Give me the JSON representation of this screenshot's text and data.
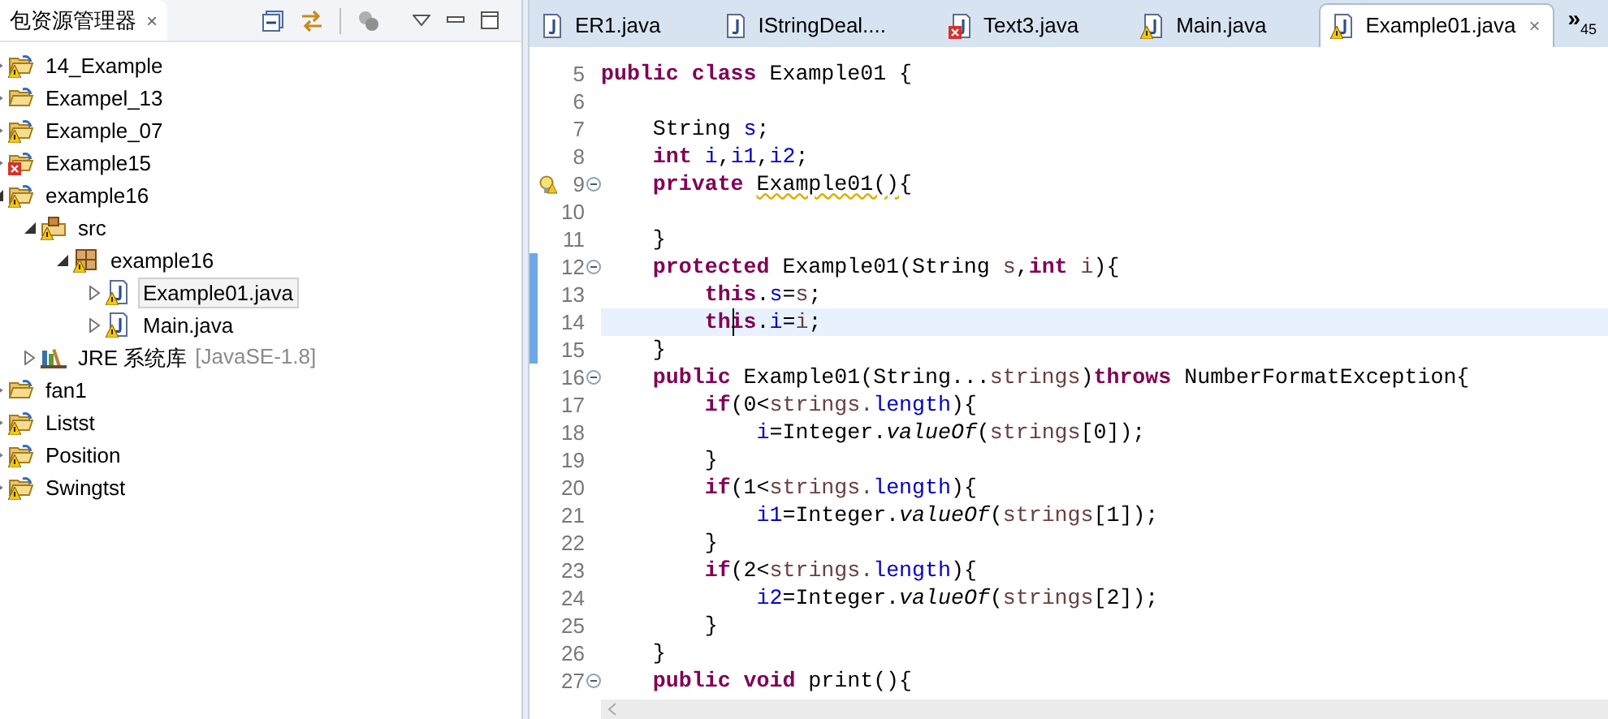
{
  "explorer": {
    "title": "包资源管理器",
    "close": "×",
    "tree": [
      {
        "label": "14_Example",
        "kind": "project",
        "warning": true,
        "error": false,
        "expanded": false,
        "selected": false
      },
      {
        "label": "Exampel_13",
        "kind": "project",
        "warning": false,
        "error": false,
        "expanded": false,
        "selected": false
      },
      {
        "label": "Example_07",
        "kind": "project",
        "warning": true,
        "error": false,
        "expanded": false,
        "selected": false
      },
      {
        "label": "Example15",
        "kind": "project",
        "warning": false,
        "error": true,
        "expanded": false,
        "selected": false
      },
      {
        "label": "example16",
        "kind": "project",
        "warning": true,
        "error": false,
        "expanded": true,
        "selected": false,
        "children": [
          {
            "label": "src",
            "kind": "source-folder",
            "warning": true,
            "error": false,
            "expanded": true,
            "selected": false,
            "children": [
              {
                "label": "example16",
                "kind": "package",
                "warning": true,
                "error": false,
                "expanded": true,
                "selected": false,
                "children": [
                  {
                    "label": "Example01.java",
                    "kind": "java-file",
                    "warning": true,
                    "error": false,
                    "expanded": false,
                    "selected": true
                  },
                  {
                    "label": "Main.java",
                    "kind": "java-file",
                    "warning": true,
                    "error": false,
                    "expanded": false,
                    "selected": false
                  }
                ]
              }
            ]
          },
          {
            "label": "JRE 系统库",
            "detail": "[JavaSE-1.8]",
            "kind": "library",
            "warning": false,
            "error": false,
            "expanded": false,
            "selected": false
          }
        ]
      },
      {
        "label": "fan1",
        "kind": "project",
        "warning": false,
        "error": false,
        "expanded": false,
        "selected": false
      },
      {
        "label": "Listst",
        "kind": "project",
        "warning": true,
        "error": false,
        "expanded": false,
        "selected": false
      },
      {
        "label": "Position",
        "kind": "project",
        "warning": true,
        "error": false,
        "expanded": false,
        "selected": false
      },
      {
        "label": "Swingtst",
        "kind": "project",
        "warning": true,
        "error": false,
        "expanded": false,
        "selected": false
      }
    ]
  },
  "editor": {
    "tabs": [
      {
        "label": "ER1.java",
        "warning": false,
        "error": false,
        "selected": false
      },
      {
        "label": "IStringDeal....",
        "warning": false,
        "error": false,
        "selected": false
      },
      {
        "label": "Text3.java",
        "warning": false,
        "error": true,
        "selected": false
      },
      {
        "label": "Main.java",
        "warning": true,
        "error": false,
        "selected": false
      },
      {
        "label": "Example01.java",
        "warning": true,
        "error": false,
        "selected": true
      }
    ],
    "tab_close": "×",
    "overflow": "»",
    "overflow_count": "45",
    "lines": [
      {
        "number": "5",
        "fold": false,
        "warning": false,
        "changed": false,
        "current": false,
        "tokens": [
          {
            "kind": "keyword",
            "text": "public class"
          },
          {
            "kind": "plain",
            "text": " Example01 {"
          }
        ]
      },
      {
        "number": "6",
        "fold": false,
        "warning": false,
        "changed": false,
        "current": false
      },
      {
        "number": "7",
        "fold": false,
        "warning": false,
        "changed": false,
        "current": false,
        "tokens": [
          {
            "kind": "plain",
            "text": "    String "
          },
          {
            "kind": "field",
            "text": "s"
          },
          {
            "kind": "plain",
            "text": ";"
          }
        ]
      },
      {
        "number": "8",
        "fold": false,
        "warning": false,
        "changed": false,
        "current": false,
        "tokens": [
          {
            "kind": "keyword",
            "text": "    int "
          },
          {
            "kind": "field",
            "text": "i"
          },
          {
            "kind": "plain",
            "text": ","
          },
          {
            "kind": "field",
            "text": "i1"
          },
          {
            "kind": "plain",
            "text": ","
          },
          {
            "kind": "field",
            "text": "i2"
          },
          {
            "kind": "plain",
            "text": ";"
          }
        ]
      },
      {
        "number": "9",
        "fold": true,
        "warning": true,
        "changed": false,
        "current": false,
        "tokens": [
          {
            "kind": "keyword",
            "text": "    private "
          },
          {
            "kind": "warned",
            "text": "Example01()"
          },
          {
            "kind": "plain",
            "text": "{"
          }
        ]
      },
      {
        "number": "10",
        "fold": false,
        "warning": false,
        "changed": false,
        "current": false
      },
      {
        "number": "11",
        "fold": false,
        "warning": false,
        "changed": false,
        "current": false,
        "tokens": [
          {
            "kind": "plain",
            "text": "    }"
          }
        ]
      },
      {
        "number": "12",
        "fold": true,
        "warning": false,
        "changed": true,
        "current": false,
        "tokens": [
          {
            "kind": "keyword",
            "text": "    protected"
          },
          {
            "kind": "plain",
            "text": " Example01(String "
          },
          {
            "kind": "variable",
            "text": "s"
          },
          {
            "kind": "plain",
            "text": ","
          },
          {
            "kind": "keyword",
            "text": "int "
          },
          {
            "kind": "variable",
            "text": "i"
          },
          {
            "kind": "plain",
            "text": "){"
          }
        ]
      },
      {
        "number": "13",
        "fold": false,
        "warning": false,
        "changed": true,
        "current": false,
        "tokens": [
          {
            "kind": "keyword",
            "text": "        this"
          },
          {
            "kind": "plain",
            "text": "."
          },
          {
            "kind": "field",
            "text": "s"
          },
          {
            "kind": "plain",
            "text": "="
          },
          {
            "kind": "variable",
            "text": "s"
          },
          {
            "kind": "plain",
            "text": ";"
          }
        ]
      },
      {
        "number": "14",
        "fold": false,
        "warning": false,
        "changed": true,
        "current": true,
        "tokens": [
          {
            "kind": "keyword",
            "text": "        this"
          },
          {
            "kind": "plain",
            "text": "."
          },
          {
            "kind": "field",
            "text": "i"
          },
          {
            "kind": "plain",
            "text": "="
          },
          {
            "kind": "variable",
            "text": "i"
          },
          {
            "kind": "plain",
            "text": ";"
          }
        ]
      },
      {
        "number": "15",
        "fold": false,
        "warning": false,
        "changed": true,
        "current": false,
        "tokens": [
          {
            "kind": "plain",
            "text": "    }"
          }
        ]
      },
      {
        "number": "16",
        "fold": true,
        "warning": false,
        "changed": false,
        "current": false,
        "tokens": [
          {
            "kind": "keyword",
            "text": "    public"
          },
          {
            "kind": "plain",
            "text": " Example01(String..."
          },
          {
            "kind": "variable",
            "text": "strings"
          },
          {
            "kind": "plain",
            "text": ")"
          },
          {
            "kind": "keyword",
            "text": "throws"
          },
          {
            "kind": "plain",
            "text": " NumberFormatException{"
          }
        ]
      },
      {
        "number": "17",
        "fold": false,
        "warning": false,
        "changed": false,
        "current": false,
        "tokens": [
          {
            "kind": "keyword",
            "text": "        if"
          },
          {
            "kind": "plain",
            "text": "(0<"
          },
          {
            "kind": "variable",
            "text": "strings."
          },
          {
            "kind": "field",
            "text": "length"
          },
          {
            "kind": "plain",
            "text": "){"
          }
        ]
      },
      {
        "number": "18",
        "fold": false,
        "warning": false,
        "changed": false,
        "current": false,
        "tokens": [
          {
            "kind": "field",
            "text": "            i"
          },
          {
            "kind": "plain",
            "text": "=Integer."
          },
          {
            "kind": "static",
            "text": "valueOf"
          },
          {
            "kind": "plain",
            "text": "("
          },
          {
            "kind": "variable",
            "text": "strings"
          },
          {
            "kind": "plain",
            "text": "[0]);"
          }
        ]
      },
      {
        "number": "19",
        "fold": false,
        "warning": false,
        "changed": false,
        "current": false,
        "tokens": [
          {
            "kind": "plain",
            "text": "        }"
          }
        ]
      },
      {
        "number": "20",
        "fold": false,
        "warning": false,
        "changed": false,
        "current": false,
        "tokens": [
          {
            "kind": "keyword",
            "text": "        if"
          },
          {
            "kind": "plain",
            "text": "(1<"
          },
          {
            "kind": "variable",
            "text": "strings."
          },
          {
            "kind": "field",
            "text": "length"
          },
          {
            "kind": "plain",
            "text": "){"
          }
        ]
      },
      {
        "number": "21",
        "fold": false,
        "warning": false,
        "changed": false,
        "current": false,
        "tokens": [
          {
            "kind": "field",
            "text": "            i1"
          },
          {
            "kind": "plain",
            "text": "=Integer."
          },
          {
            "kind": "static",
            "text": "valueOf"
          },
          {
            "kind": "plain",
            "text": "("
          },
          {
            "kind": "variable",
            "text": "strings"
          },
          {
            "kind": "plain",
            "text": "[1]);"
          }
        ]
      },
      {
        "number": "22",
        "fold": false,
        "warning": false,
        "changed": false,
        "current": false,
        "tokens": [
          {
            "kind": "plain",
            "text": "        }"
          }
        ]
      },
      {
        "number": "23",
        "fold": false,
        "warning": false,
        "changed": false,
        "current": false,
        "tokens": [
          {
            "kind": "keyword",
            "text": "        if"
          },
          {
            "kind": "plain",
            "text": "(2<"
          },
          {
            "kind": "variable",
            "text": "strings."
          },
          {
            "kind": "field",
            "text": "length"
          },
          {
            "kind": "plain",
            "text": "){"
          }
        ]
      },
      {
        "number": "24",
        "fold": false,
        "warning": false,
        "changed": false,
        "current": false,
        "tokens": [
          {
            "kind": "field",
            "text": "            i2"
          },
          {
            "kind": "plain",
            "text": "=Integer."
          },
          {
            "kind": "static",
            "text": "valueOf"
          },
          {
            "kind": "plain",
            "text": "("
          },
          {
            "kind": "variable",
            "text": "strings"
          },
          {
            "kind": "plain",
            "text": "[2]);"
          }
        ]
      },
      {
        "number": "25",
        "fold": false,
        "warning": false,
        "changed": false,
        "current": false,
        "tokens": [
          {
            "kind": "plain",
            "text": "        }"
          }
        ]
      },
      {
        "number": "26",
        "fold": false,
        "warning": false,
        "changed": false,
        "current": false,
        "tokens": [
          {
            "kind": "plain",
            "text": "    }"
          }
        ]
      },
      {
        "number": "27",
        "fold": true,
        "warning": false,
        "changed": false,
        "current": false,
        "tokens": [
          {
            "kind": "keyword",
            "text": "    public void"
          },
          {
            "kind": "plain",
            "text": " print(){"
          }
        ]
      }
    ]
  }
}
